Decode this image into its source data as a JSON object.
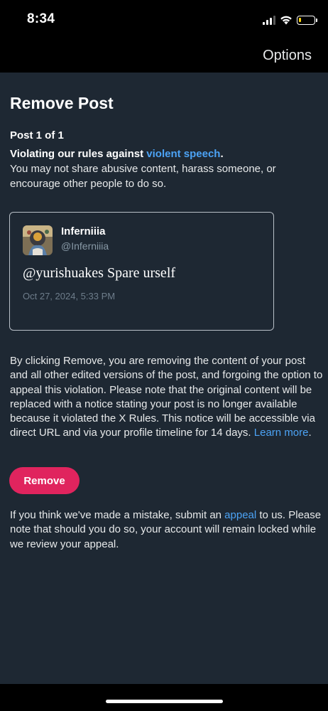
{
  "status_bar": {
    "time": "8:34",
    "battery_level": 0.15,
    "battery_color": "#ffd60a",
    "icons": [
      "cellular-signal-icon",
      "wifi-icon",
      "battery-icon"
    ]
  },
  "nav": {
    "options_label": "Options"
  },
  "page": {
    "title": "Remove Post",
    "post_count": "Post 1 of 1",
    "violation_prefix": "Violating our rules against ",
    "violation_link": "violent speech",
    "violation_suffix": ".",
    "violation_description": "You may not share abusive content, harass someone, or encourage other people to do so."
  },
  "post": {
    "author_name": "Inferniiia",
    "author_handle": "@Inferniiia",
    "text": "@yurishuakes Spare urself",
    "date": "Oct 27, 2024, 5:33 PM"
  },
  "explanation": {
    "text": "By clicking Remove, you are removing the content of your post and all other edited versions of the post, and forgoing the option to appeal this violation. Please note that the original content will be replaced with a notice stating your post is no longer available because it violated the X Rules. This notice will be accessible via direct URL and via your profile timeline for 14 days. ",
    "learn_more": "Learn more",
    "end": "."
  },
  "actions": {
    "remove_label": "Remove"
  },
  "appeal": {
    "prefix": "If you think we've made a mistake, submit an ",
    "link": "appeal",
    "suffix": " to us. Please note that should you do so, your account will remain locked while we review your appeal."
  },
  "colors": {
    "accent_link": "#4ca3f5",
    "remove_button": "#e0245e",
    "background": "#1e2833"
  }
}
